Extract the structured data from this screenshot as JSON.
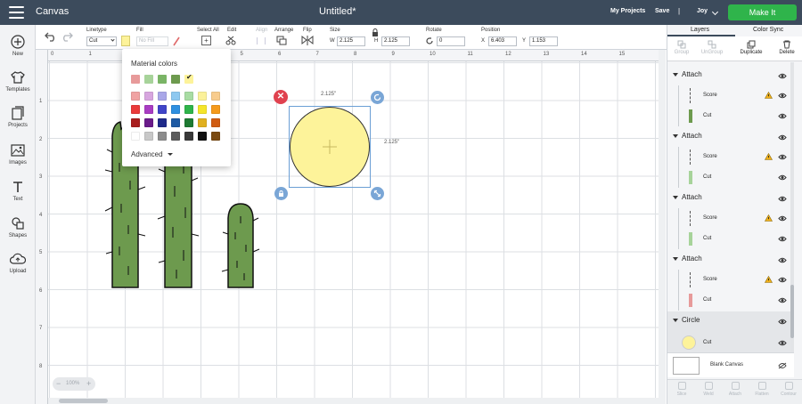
{
  "header": {
    "app_title": "Canvas",
    "doc_title": "Untitled*",
    "my_projects": "My Projects",
    "save": "Save",
    "separator": "|",
    "user": "Joy",
    "make_it": "Make It"
  },
  "options": {
    "linetype_label": "Linetype",
    "linetype_value": "Cut",
    "fill_label": "Fill",
    "fill_value": "No Fill",
    "select_all_label": "Select All",
    "edit_label": "Edit",
    "align_label": "Align",
    "arrange_label": "Arrange",
    "flip_label": "Flip",
    "size_label": "Size",
    "w_label": "W",
    "w_value": "2.125",
    "h_label": "H",
    "h_value": "2.125",
    "rotate_label": "Rotate",
    "rotate_value": "0",
    "position_label": "Position",
    "x_label": "X",
    "x_value": "6.403",
    "y_label": "Y",
    "y_value": "1.153"
  },
  "nav": [
    {
      "label": "New"
    },
    {
      "label": "Templates"
    },
    {
      "label": "Projects"
    },
    {
      "label": "Images"
    },
    {
      "label": "Text"
    },
    {
      "label": "Shapes"
    },
    {
      "label": "Upload"
    }
  ],
  "ruler_x": [
    "0",
    "1",
    "2",
    "3",
    "4",
    "5",
    "6",
    "7",
    "8",
    "9",
    "10",
    "11",
    "12",
    "13",
    "14",
    "15"
  ],
  "ruler_y": [
    "1",
    "2",
    "3",
    "4",
    "5",
    "6",
    "7",
    "8"
  ],
  "material_popup": {
    "title": "Material colors",
    "advanced": "Advanced",
    "recent": [
      "#e79a9a",
      "#a7d39a",
      "#7ab466",
      "#6d9a4e",
      "#fdf39a"
    ],
    "palette": [
      [
        "#f0a3a3",
        "#d7a6df",
        "#a9a7e8",
        "#8ec8f0",
        "#a8dca3",
        "#fbf19a",
        "#f8cc8d"
      ],
      [
        "#ea3b3b",
        "#a93dc3",
        "#4045c8",
        "#2e8fe0",
        "#2fb44b",
        "#f5e52a",
        "#f59a1c"
      ],
      [
        "#a91e1e",
        "#6a1c8a",
        "#1f2a8a",
        "#1e5aa3",
        "#1e7a32",
        "#e0b020",
        "#d05c12"
      ],
      [
        "#ffffff",
        "#c8c8c8",
        "#8c8c8c",
        "#5c5c5c",
        "#393939",
        "#111111",
        "#7a4a12"
      ]
    ]
  },
  "canvas": {
    "size_top": "2.125\"",
    "size_right": "2.125\"",
    "zoom": "100%",
    "circle_color": "#fdf39a",
    "cactus_color": "#6d9a4e"
  },
  "layers_panel": {
    "tab_layers": "Layers",
    "tab_color_sync": "Color Sync",
    "tools": [
      "Group",
      "UnGroup",
      "Duplicate",
      "Delete"
    ],
    "groups": [
      {
        "name": "Attach",
        "items": [
          {
            "name": "Score",
            "warn": true
          },
          {
            "name": "Cut",
            "color": "#6d9a4e"
          }
        ]
      },
      {
        "name": "Attach",
        "items": [
          {
            "name": "Score",
            "warn": true
          },
          {
            "name": "Cut",
            "color": "#a7d39a"
          }
        ]
      },
      {
        "name": "Attach",
        "items": [
          {
            "name": "Score",
            "warn": true
          },
          {
            "name": "Cut",
            "color": "#a7d39a"
          }
        ]
      },
      {
        "name": "Attach",
        "items": [
          {
            "name": "Score",
            "warn": true
          },
          {
            "name": "Cut",
            "color": "#e79a9a"
          }
        ]
      },
      {
        "name": "Circle",
        "items": [
          {
            "name": "Cut",
            "color": "#fdf39a"
          }
        ]
      }
    ],
    "blank_canvas": "Blank Canvas",
    "bottom": [
      "Slice",
      "Weld",
      "Attach",
      "Flatten",
      "Contour"
    ]
  }
}
